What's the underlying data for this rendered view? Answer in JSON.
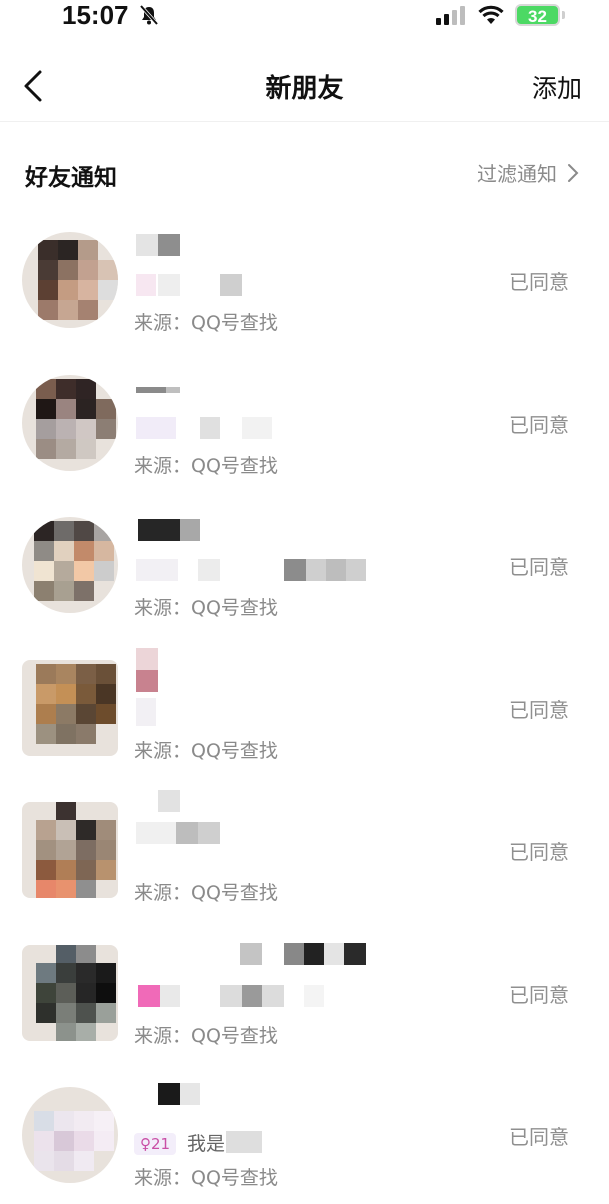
{
  "status_bar": {
    "time": "15:07",
    "battery": "32",
    "icons": [
      "mute-icon",
      "signal-icon",
      "wifi-icon",
      "battery-icon"
    ]
  },
  "nav": {
    "title": "新朋友",
    "add_label": "添加",
    "back_icon": "chevron-left-icon"
  },
  "section": {
    "title": "好友通知",
    "filter_label": "过滤通知",
    "filter_icon": "chevron-right-icon"
  },
  "friends": [
    {
      "source": "来源：QQ号查找",
      "status": "已同意"
    },
    {
      "source": "来源：QQ号查找",
      "status": "已同意"
    },
    {
      "source": "来源：QQ号查找",
      "status": "已同意"
    },
    {
      "source": "来源：QQ号查找",
      "status": "已同意"
    },
    {
      "source": "来源：QQ号查找",
      "status": "已同意"
    },
    {
      "source": "来源：QQ号查找",
      "status": "已同意"
    },
    {
      "source": "来源：QQ号查找",
      "status": "已同意",
      "age": "♀21",
      "bio": "我是"
    }
  ],
  "colors": {
    "accent_pink": "#c94fa6",
    "secondary_text": "#8a8a8a",
    "battery_green": "#4cd964"
  }
}
